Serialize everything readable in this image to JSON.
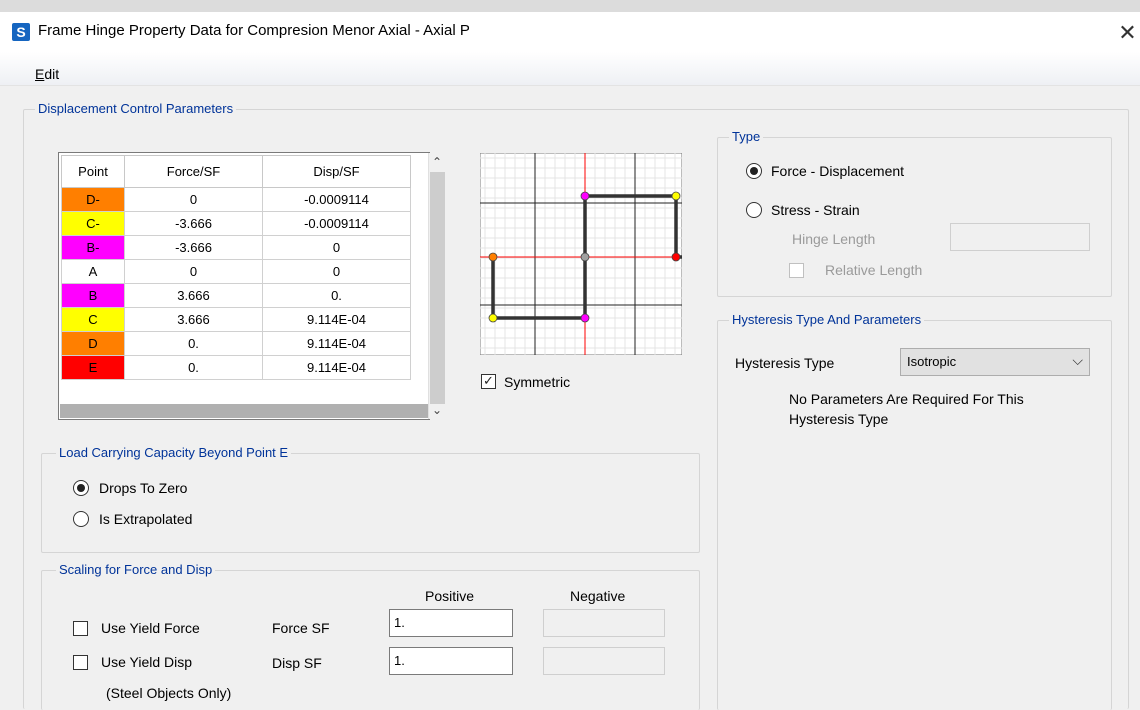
{
  "window": {
    "title": "Frame Hinge Property Data for Compresion Menor Axial - Axial P",
    "app_icon": "S",
    "close": "✕"
  },
  "menu": {
    "edit_first": "E",
    "edit_rest": "dit"
  },
  "displacement": {
    "legend": "Displacement Control Parameters",
    "headers": [
      "Point",
      "Force/SF",
      "Disp/SF"
    ],
    "rows": [
      {
        "point": "D-",
        "force": "0",
        "disp": "-0.0009114",
        "color": "#ff7f00"
      },
      {
        "point": "C-",
        "force": "-3.666",
        "disp": "-0.0009114",
        "color": "#ffff00"
      },
      {
        "point": "B-",
        "force": "-3.666",
        "disp": "0",
        "color": "#ff00ff"
      },
      {
        "point": "A",
        "force": "0",
        "disp": "0",
        "color": "#ffffff"
      },
      {
        "point": "B",
        "force": "3.666",
        "disp": "0.",
        "color": "#ff00ff"
      },
      {
        "point": "C",
        "force": "3.666",
        "disp": "9.114E-04",
        "color": "#ffff00"
      },
      {
        "point": "D",
        "force": "0.",
        "disp": "9.114E-04",
        "color": "#ff7f00"
      },
      {
        "point": "E",
        "force": "0.",
        "disp": "9.114E-04",
        "color": "#ff0000"
      }
    ],
    "symmetric_label": "Symmetric",
    "symmetric_checked": true
  },
  "load_capacity": {
    "legend": "Load Carrying Capacity Beyond Point E",
    "option1": "Drops To Zero",
    "option2": "Is Extrapolated",
    "selected": "Drops To Zero"
  },
  "scaling": {
    "legend": "Scaling for Force and Disp",
    "positive_header": "Positive",
    "negative_header": "Negative",
    "use_yield_force": "Use Yield Force",
    "use_yield_disp": "Use Yield Disp",
    "steel_note": "(Steel Objects Only)",
    "force_sf_label": "Force SF",
    "disp_sf_label": "Disp SF",
    "force_sf_positive": "1.",
    "disp_sf_positive": "1."
  },
  "type": {
    "legend": "Type",
    "force_displacement": "Force - Displacement",
    "stress_strain": "Stress - Strain",
    "hinge_length": "Hinge Length",
    "relative_length": "Relative Length",
    "selected": "Force - Displacement"
  },
  "hysteresis": {
    "legend": "Hysteresis Type And Parameters",
    "label": "Hysteresis Type",
    "value": "Isotropic",
    "note_line1": "No Parameters Are Required For This",
    "note_line2": "Hysteresis Type"
  }
}
